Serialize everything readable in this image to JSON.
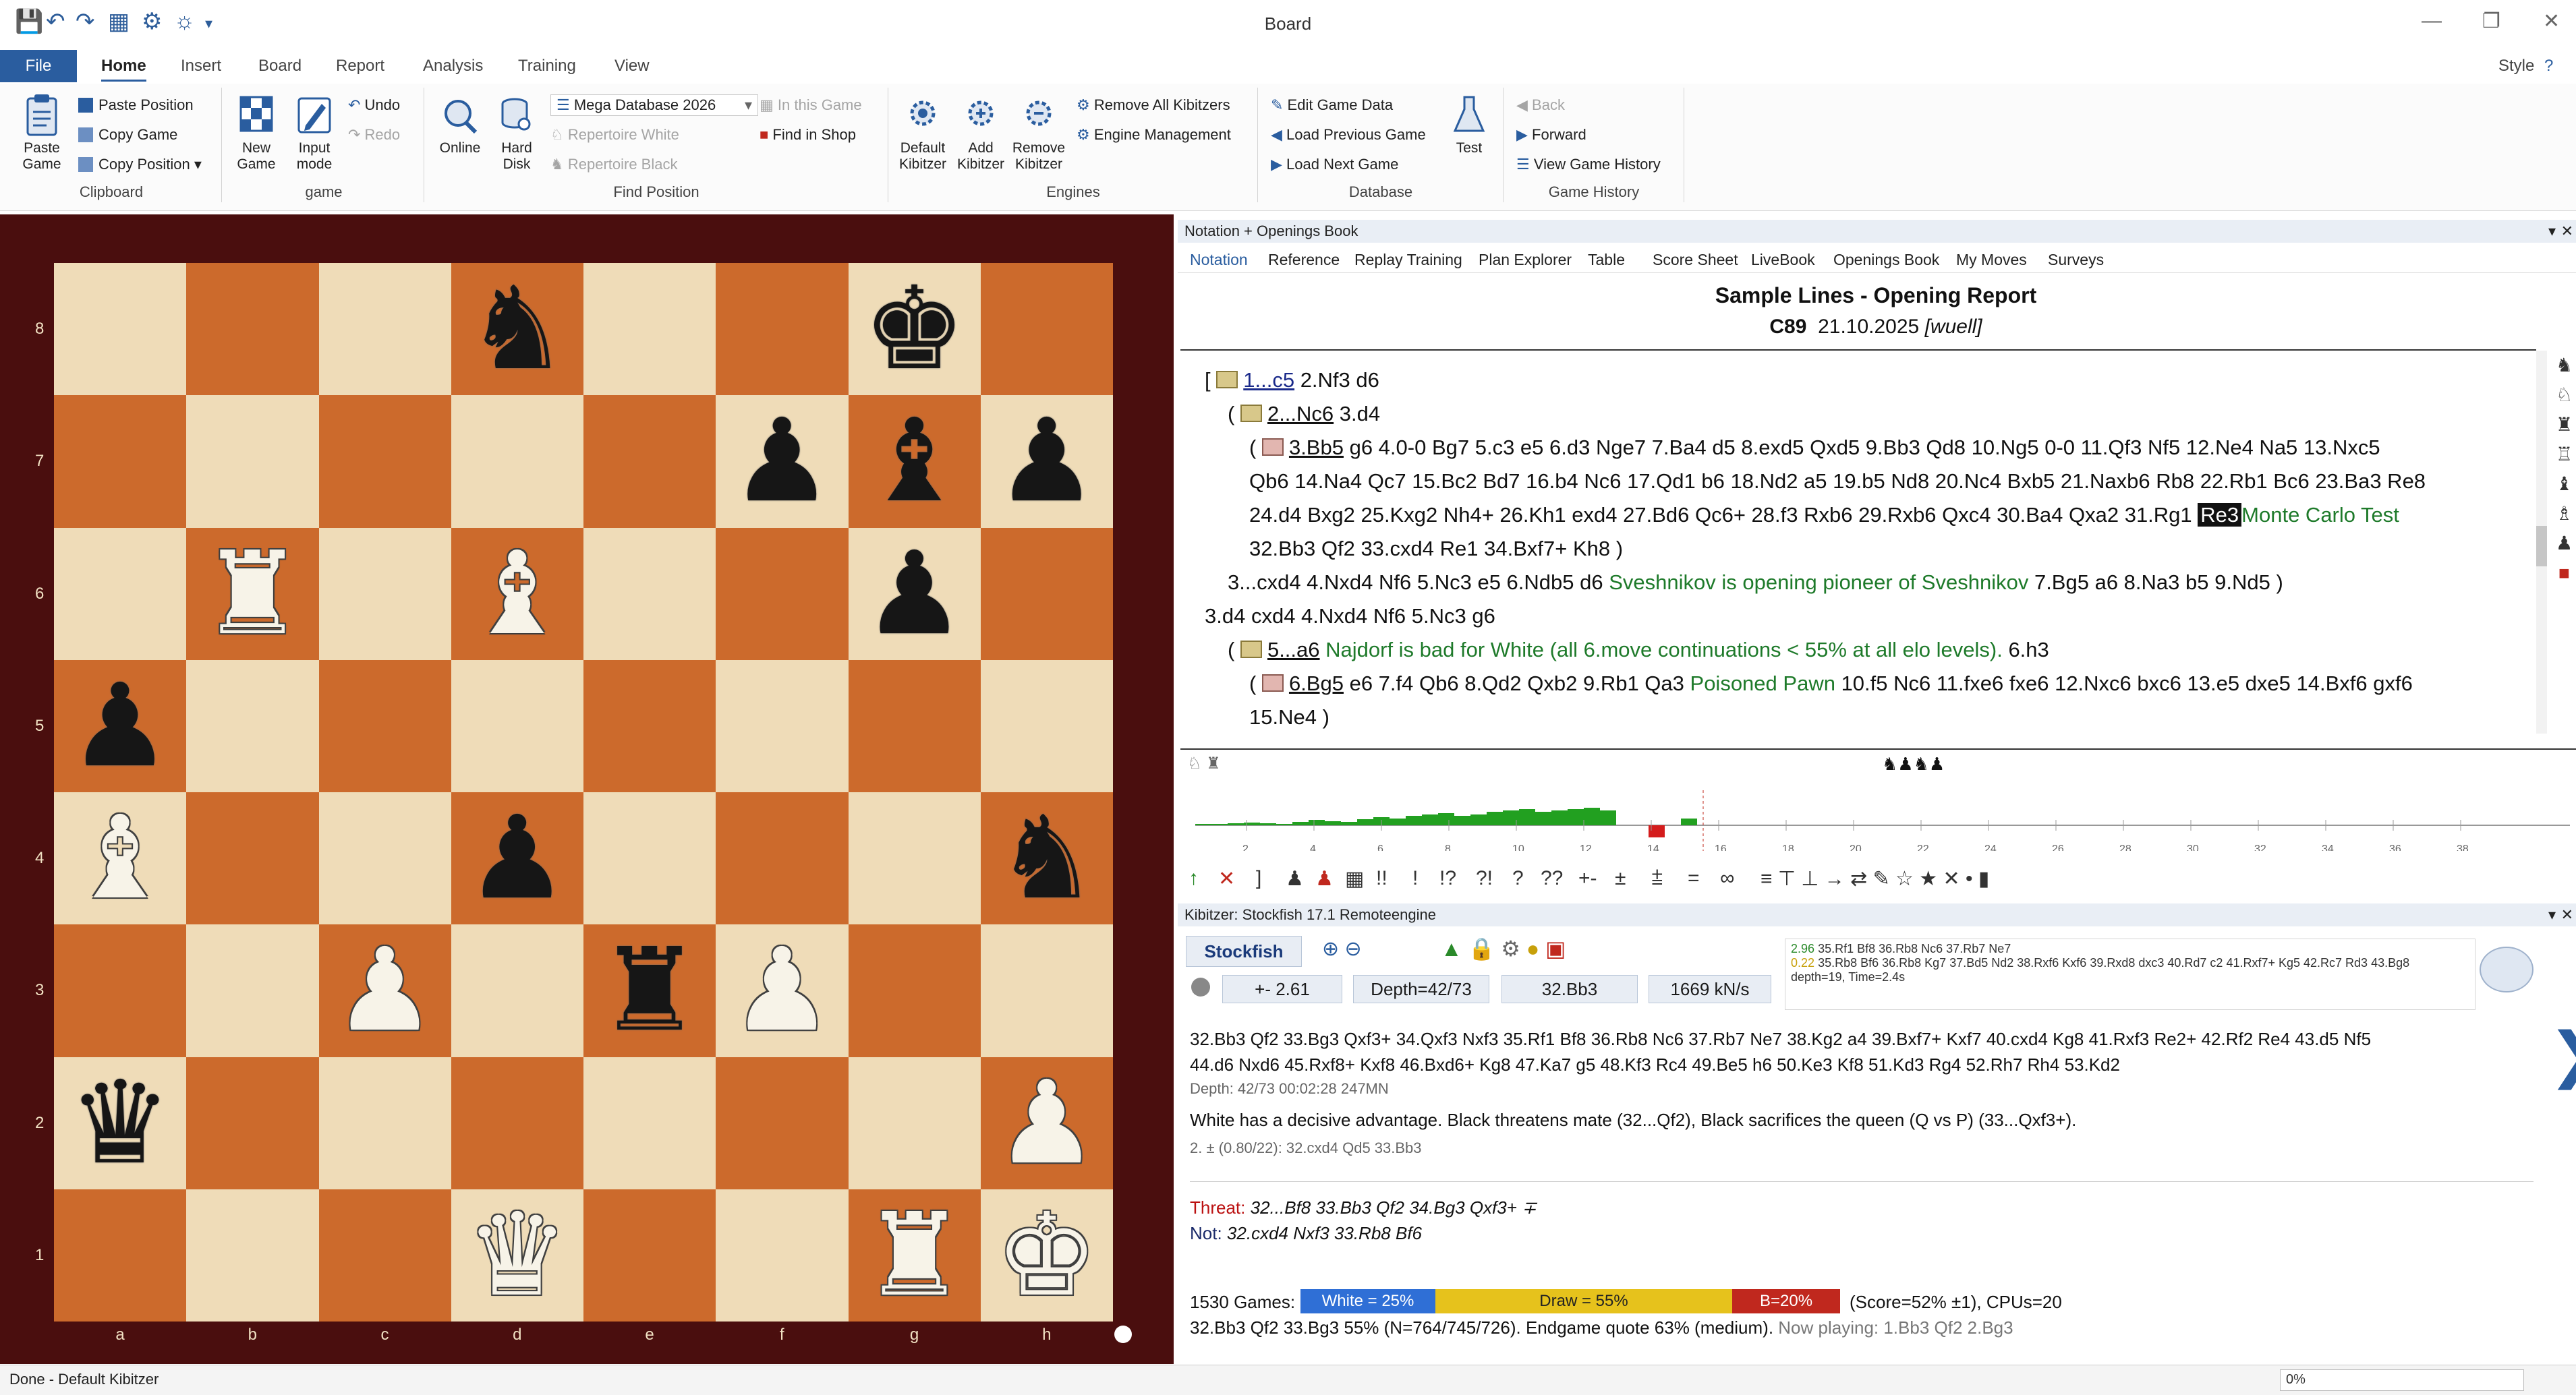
{
  "window": {
    "title": "Board",
    "style_label": "Style"
  },
  "menu": {
    "file": "File",
    "tabs": [
      "Home",
      "Insert",
      "Board",
      "Report",
      "Analysis",
      "Training",
      "View"
    ]
  },
  "ribbon": {
    "clipboard": {
      "label": "Clipboard",
      "paste_game": "Paste Game",
      "paste_position": "Paste Position",
      "copy_game": "Copy Game",
      "copy_position": "Copy Position"
    },
    "game": {
      "label": "game",
      "undo": "Undo",
      "redo": "Redo",
      "new_game": "New Game",
      "input_mode": "Input mode"
    },
    "find_position": {
      "label": "Find Position",
      "online": "Online",
      "hard_disk": "Hard Disk",
      "database": "Mega Database 2026",
      "repertoire_white": "Repertoire White",
      "repertoire_black": "Repertoire Black",
      "in_this_game": "In this Game",
      "find_in_shop": "Find in Shop"
    },
    "engines": {
      "label": "Engines",
      "default_kibitzer": "Default Kibitzer",
      "add_kibitzer": "Add Kibitzer",
      "remove_kibitzer": "Remove Kibitzer",
      "remove_all": "Remove All Kibitzers",
      "engine_management": "Engine Management"
    },
    "database": {
      "label": "Database",
      "edit_game_data": "Edit Game Data",
      "load_previous": "Load Previous Game",
      "load_next": "Load Next Game",
      "test": "Test"
    },
    "history": {
      "label": "Game History",
      "back": "Back",
      "forward": "Forward",
      "view_history": "View Game History"
    }
  },
  "board": {
    "ranks": [
      "8",
      "7",
      "6",
      "5",
      "4",
      "3",
      "2",
      "1"
    ],
    "files": [
      "a",
      "b",
      "c",
      "d",
      "e",
      "f",
      "g",
      "h"
    ]
  },
  "notation_panel": {
    "header": "Notation + Openings Book",
    "tabs": [
      "Notation",
      "Reference",
      "Replay Training",
      "Plan Explorer",
      "Table",
      "Score Sheet",
      "LiveBook",
      "Openings Book",
      "My Moves",
      "Surveys"
    ],
    "game_title": "Sample Lines - Opening Report",
    "eco": "C89",
    "date": "21.10.2025",
    "author": "[wuell]",
    "lines": {
      "l1_open": "[",
      "l1_move": "1...c5",
      "l1_rest": " 2.Nf3  d6",
      "l2_open": "(",
      "l2_move": "2...Nc6",
      "l2_rest": " 3.d4",
      "l3_open": "(",
      "l3_move": "3.Bb5",
      "l3_rest": " g6  4.0-0  Bg7  5.c3  e5  6.d3  Nge7  7.Ba4  d5  8.exd5  Qxd5  9.Bb3  Qd8  10.Ng5  0-0  11.Qf3  Nf5  12.Ne4  Na5  13.Nxc5",
      "l4": "Qb6  14.Na4  Qc7  15.Bc2  Bd7  16.b4  Nc6  17.Qd1  b6  18.Nd2  a5  19.b5  Nd8  20.Nc4  Bxb5  21.Naxb6  Rb8  22.Rb1  Bc6  23.Ba3  Re8",
      "l5_a": "24.d4  Bxg2  25.Kxg2  Nh4+  26.Kh1  exd4  27.Bd6  Qc6+  28.f3  Rxb6  29.Rxb6  Qxc4  30.Ba4  Qxa2  31.Rg1 ",
      "l5_hl": "Re3",
      "l5_cm": "Monte Carlo Test",
      "l6": "32.Bb3  Qf2  33.cxd4  Re1  34.Bxf7+  Kh8 )",
      "l7_a": "3...cxd4  4.Nxd4  Nf6  5.Nc3  e5  6.Ndb5  d6 ",
      "l7_cm": "Sveshnikov is opening pioneer of Sveshnikov",
      "l7_b": " 7.Bg5  a6  8.Na3  b5  9.Nd5 )",
      "l8": "3.d4  cxd4  4.Nxd4  Nf6  5.Nc3  g6",
      "l9_open": "(",
      "l9_move": "5...a6",
      "l9_cm": " Najdorf is bad for White (all 6.move continuations < 55% at all elo levels).",
      "l9_rest": "  6.h3",
      "l10_open": "(",
      "l10_move": "6.Bg5",
      "l10_a": " e6  7.f4  Qb6  8.Qd2  Qxb2  9.Rb1  Qa3 ",
      "l10_cm": "Poisoned Pawn",
      "l10_b": "  10.f5  Nc6  11.fxe6  fxe6  12.Nxc6  bxc6  13.e5  dxe5  14.Bxf6  gxf6",
      "l11": "15.Ne4 )"
    },
    "graph_ticks": [
      "2",
      "4",
      "6",
      "8",
      "10",
      "12",
      "14",
      "16",
      "18",
      "20",
      "22",
      "24",
      "26",
      "28",
      "30",
      "32",
      "34",
      "36",
      "38"
    ],
    "annotation_symbols": [
      "!!",
      "!",
      "!?",
      "?!",
      "?",
      "??",
      "+-",
      "±",
      "⩲",
      "=",
      "∞"
    ]
  },
  "kibitzer": {
    "header": "Kibitzer: Stockfish 17.1 Remoteengine",
    "engine_name": "Stockfish 17.1",
    "eval": "+- 2.61",
    "depth": "Depth=42/73",
    "move": "32.Bb3",
    "speed": "1669 kN/s",
    "preview_line1_eval": "2.96",
    "preview_line1": "35.Rf1 Bf8 36.Rb8 Nc6 37.Rb7 Ne7",
    "preview_line2_eval": "0.22",
    "preview_line2": "35.Rb8 Bf6 36.Rb8 Kg7 37.Bd5 Nd2 38.Rxf6 Kxf6 39.Rxd8 dxc3 40.Rd7 c2 41.Rxf7+ Kg5 42.Rc7 Rd3 43.Bg8",
    "preview_depth": "depth=19, Time=2.4s",
    "mainline_1": "32.Bb3  Qf2  33.Bg3  Qxf3+  34.Qxf3  Nxf3  35.Rf1  Bf8 36.Rb8  Nc6 37.Rb7 Ne7 38.Kg2 a4 39.Bxf7+ Kxf7 40.cxd4 Kg8 41.Rxf3 Re2+ 42.Rf2 Re4 43.d5 Nf5",
    "mainline_2": "44.d6 Nxd6 45.Rxf8+ Kxf8 46.Bxd6+ Kg8 47.Ka7 g5 48.Kf3 Rc4 49.Be5 h6 50.Ke3 Kf8 51.Kd3 Rg4 52.Rh7 Rh4 53.Kd2",
    "depth_line": "Depth: 42/73 00:02:28 247MN",
    "verdict": "White has a decisive advantage. Black threatens mate (32...Qf2), Black sacrifices the queen (Q vs P) (33...Qxf3+).",
    "alt_line": "2. ± (0.80/22):   32.cxd4 Qd5 33.Bb3",
    "threat_label": "Threat:",
    "threat": "32...Bf8 33.Bb3 Qf2 34.Bg3 Qxf3+ ∓",
    "not_label": "Not:",
    "not": "32.cxd4 Nxf3 33.Rb8 Bf6",
    "games": "1530 Games:",
    "white_pct": "White = 25%",
    "draw_pct": "Draw = 55%",
    "black_pct": "B=20%",
    "score": "(Score=52% ±1), CPUs=20",
    "summary_a": "32.Bb3 Qf2 33.Bg3  55% (N=764/745/726).  Endgame quote 63%  (medium).",
    "summary_b": "  Now playing: 1.Bb3 Qf2 2.Bg3"
  },
  "results_bar": {
    "white": 0.25,
    "draw": 0.55,
    "black": 0.2,
    "colors": {
      "white": "#2f6fd6",
      "draw": "#e6c21c",
      "black": "#c0281e"
    }
  },
  "status": {
    "text": "Done - Default Kibitzer",
    "progress": "0%"
  },
  "colors": {
    "accent": "#2a5d9f",
    "light_square": "#efdcb8",
    "dark_square": "#cc6a2c",
    "board_frame": "#4a0e0e",
    "comment_green": "#1e7a2a"
  }
}
